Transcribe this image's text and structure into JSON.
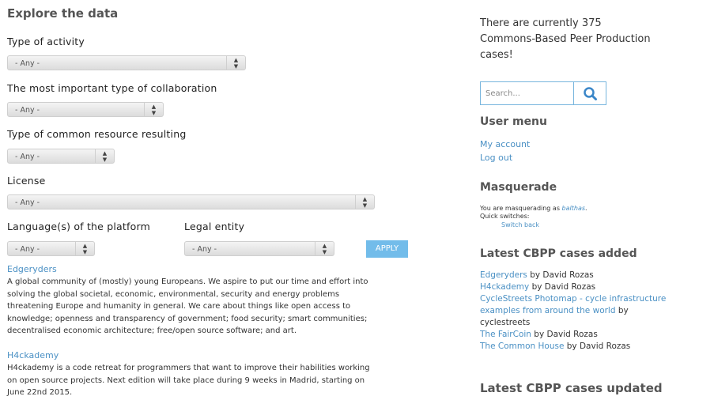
{
  "explore": {
    "heading": "Explore the data",
    "filters": [
      {
        "label": "Type of activity",
        "value": "- Any -"
      },
      {
        "label": "The most important type of collaboration",
        "value": "- Any -"
      },
      {
        "label": "Type of common resource resulting",
        "value": "- Any -"
      },
      {
        "label": "License",
        "value": "- Any -"
      },
      {
        "label": "Language(s) of the platform",
        "value": "- Any -"
      },
      {
        "label": "Legal entity",
        "value": "- Any -"
      }
    ],
    "apply_label": "APPLY"
  },
  "cases": [
    {
      "title": "Edgeryders",
      "lines": [
        "A global community of (mostly) young Europeans. We aspire to put our time and effort into",
        "solving the global societal, economic, environmental, security and energy problems",
        "threatening Europe and humanity in general. We care about things like open access to",
        "knowledge; openness and transparency of government; food security; smart communities;",
        "decentralised economic architecture; free/open source software; and art."
      ]
    },
    {
      "title": "H4ckademy",
      "lines": [
        "H4ckademy is a code retreat for programmers that want to improve their habilities working",
        "on open source projects. Next edition will take place during 9 weeks in Madrid, starting on",
        "June 22nd 2015."
      ]
    }
  ],
  "sidebar": {
    "intro_lines": [
      "There are currently 375",
      "Commons-Based Peer Production",
      "cases!"
    ],
    "search_placeholder": "Search...",
    "user_menu": {
      "heading": "User menu",
      "items": [
        "My account",
        "Log out"
      ]
    },
    "masquerade": {
      "heading": "Masquerade",
      "prefix": "You are masquerading as ",
      "user": "balthas",
      "suffix": ".",
      "quick": "Quick switches:",
      "switch_back": "Switch back"
    },
    "latest_added": {
      "heading": "Latest CBPP cases added",
      "items": [
        {
          "link": "Edgeryders",
          "by": " by David Rozas"
        },
        {
          "link": "H4ckademy",
          "by": " by David Rozas"
        },
        {
          "link": "CycleStreets Photomap - cycle infrastructure",
          "by": ""
        },
        {
          "link": "examples from around the world",
          "by": " by"
        },
        {
          "link": "",
          "by": "cyclestreets"
        },
        {
          "link": "The FairCoin",
          "by": " by David Rozas"
        },
        {
          "link": "The Common House",
          "by": " by David Rozas"
        }
      ]
    },
    "latest_updated": {
      "heading": "Latest CBPP cases updated"
    }
  }
}
